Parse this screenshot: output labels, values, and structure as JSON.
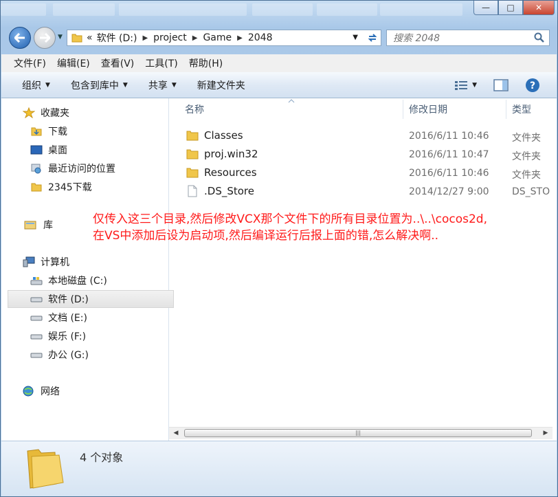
{
  "window": {
    "minimize_glyph": "—",
    "maximize_glyph": "□",
    "close_glyph": "✕"
  },
  "address": {
    "overflow": "«",
    "crumbs": [
      "软件 (D:)",
      "project",
      "Game",
      "2048"
    ]
  },
  "search": {
    "placeholder": "搜索 2048"
  },
  "menu": [
    "文件(F)",
    "编辑(E)",
    "查看(V)",
    "工具(T)",
    "帮助(H)"
  ],
  "toolbar": {
    "organize": "组织",
    "include": "包含到库中",
    "share": "共享",
    "new_folder": "新建文件夹"
  },
  "sidebar": {
    "favorites": "收藏夹",
    "fav_items": [
      "下载",
      "桌面",
      "最近访问的位置",
      "2345下载"
    ],
    "libraries": "库",
    "computer": "计算机",
    "drives": [
      "本地磁盘 (C:)",
      "软件 (D:)",
      "文档 (E:)",
      "娱乐 (F:)",
      "办公 (G:)"
    ],
    "network": "网络"
  },
  "columns": {
    "name": "名称",
    "modified": "修改日期",
    "type": "类型"
  },
  "files": [
    {
      "name": "Classes",
      "modified": "2016/6/11 10:46",
      "type": "文件夹",
      "icon": "folder-icon"
    },
    {
      "name": "proj.win32",
      "modified": "2016/6/11 10:47",
      "type": "文件夹",
      "icon": "folder-icon"
    },
    {
      "name": "Resources",
      "modified": "2016/6/11 10:46",
      "type": "文件夹",
      "icon": "folder-icon"
    },
    {
      "name": ".DS_Store",
      "modified": "2014/12/27 9:00",
      "type": "DS_STO",
      "icon": "file-icon"
    }
  ],
  "annotation": {
    "line1": "仅传入这三个目录,然后修改VCX那个文件下的所有目录位置为..\\..\\cocos2d,",
    "line2": "在VS中添加后设为启动项,然后编译运行后报上面的错,怎么解决啊.."
  },
  "status": {
    "count": "4 个对象"
  },
  "colors": {
    "annotation": "#ff1a1a",
    "accent": "#2b6fb8"
  }
}
